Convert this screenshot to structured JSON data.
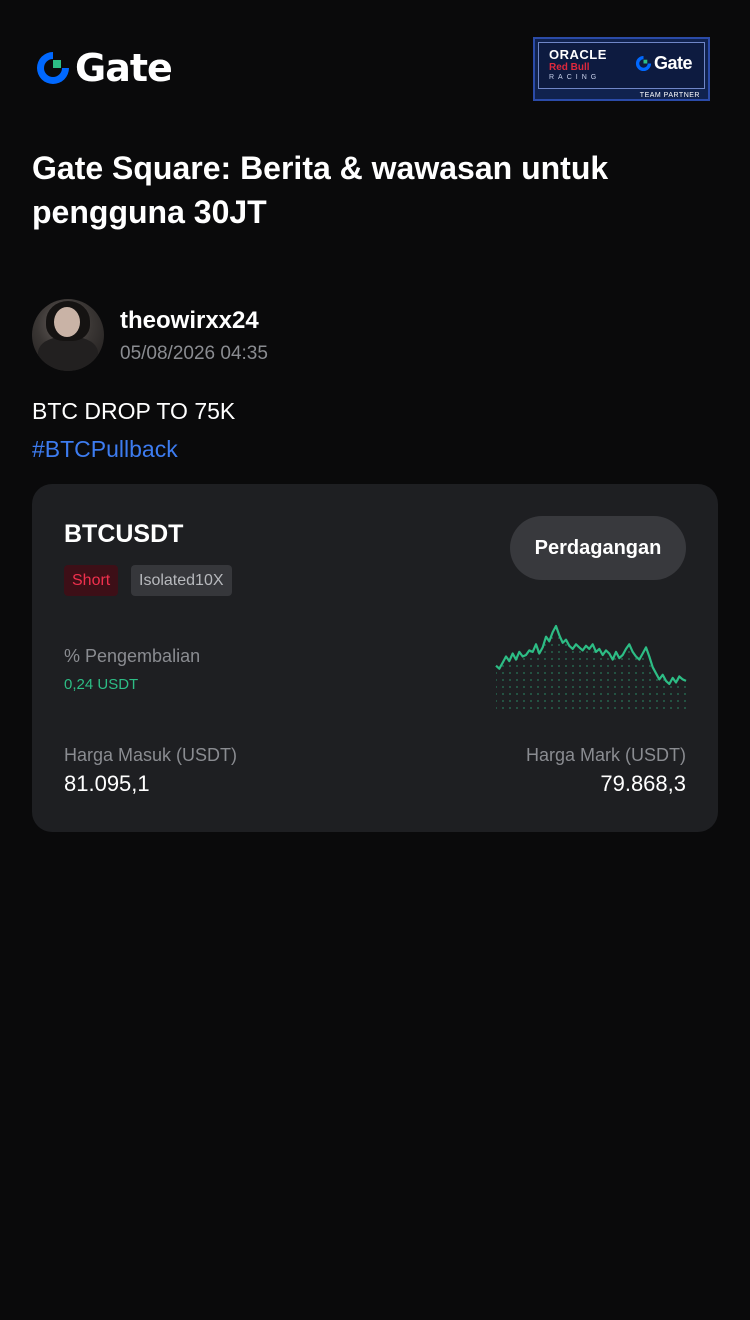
{
  "app": {
    "logo_text": "Gate",
    "brand_color": "#0068ff",
    "brand_accent": "#2dbd85"
  },
  "partner_badge": {
    "line1": "ORACLE",
    "line2": "Red Bull",
    "line3": "RACING",
    "gate_text": "Gate",
    "caption": "TEAM PARTNER"
  },
  "headline": "Gate Square: Berita & wawasan untuk pengguna 30JT",
  "post": {
    "author": {
      "username": "theowirxx24",
      "timestamp": "05/08/2026 04:35"
    },
    "text": "BTC DROP TO 75K",
    "hashtag": "#BTCPullback"
  },
  "position_card": {
    "pair": "BTCUSDT",
    "trade_button": "Perdagangan",
    "side_tag": "Short",
    "leverage_tag": "Isolated10X",
    "roi_label": "% Pengembalian",
    "roi_value": "0,24 USDT",
    "entry_label": "Harga Masuk (USDT)",
    "entry_value": "81.095,1",
    "mark_label": "Harga Mark (USDT)",
    "mark_value": "79.868,3",
    "sparkline_color": "#2dbd85",
    "sparkline_points": [
      44,
      46,
      42,
      38,
      41,
      36,
      40,
      35,
      38,
      37,
      34,
      35,
      30,
      36,
      32,
      25,
      28,
      22,
      18,
      24,
      29,
      27,
      31,
      33,
      30,
      32,
      34,
      31,
      33,
      30,
      35,
      33,
      37,
      34,
      36,
      40,
      35,
      39,
      37,
      33,
      30,
      35,
      38,
      40,
      36,
      32,
      38,
      45,
      49,
      53,
      50,
      54,
      56,
      52,
      55,
      51,
      53,
      54
    ]
  }
}
